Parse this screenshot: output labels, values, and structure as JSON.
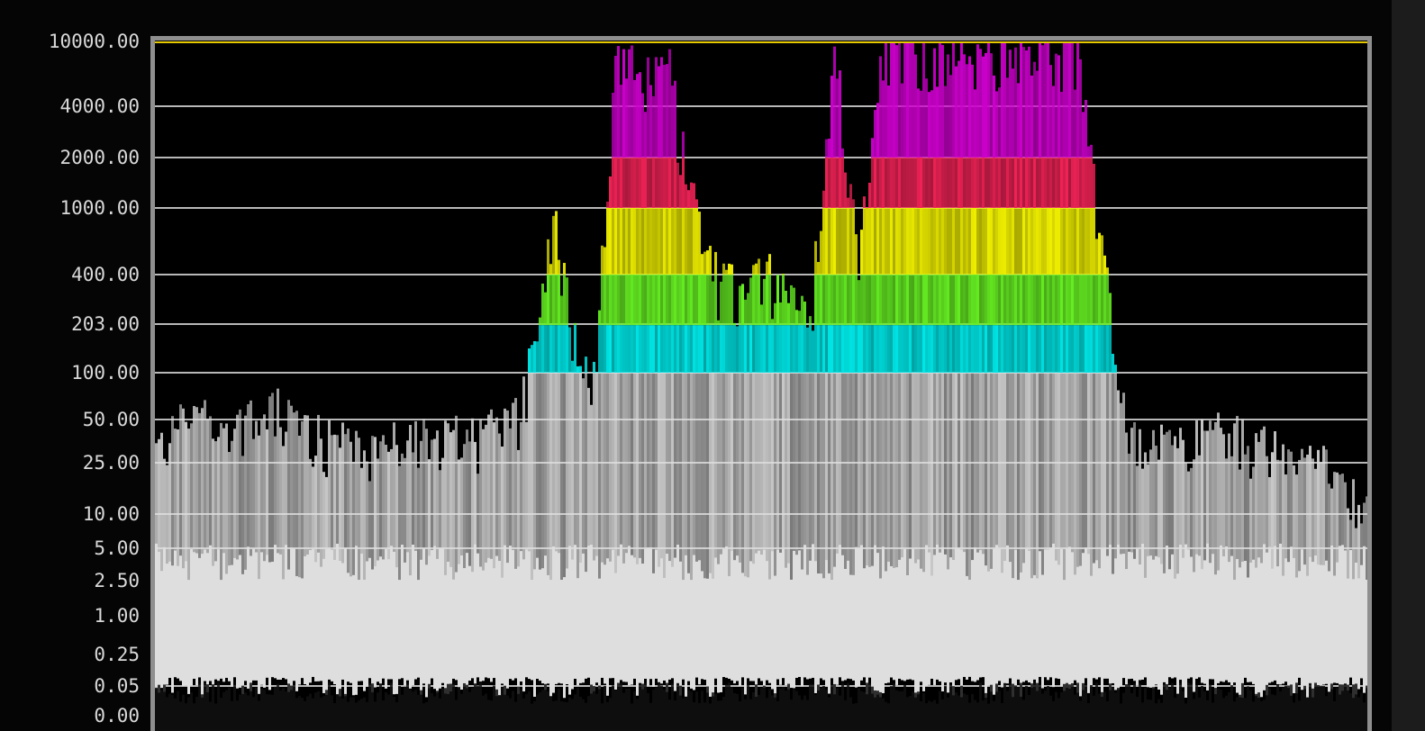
{
  "chart_data": {
    "type": "scatter",
    "title": "",
    "xlabel": "",
    "ylabel": "",
    "yscale": "log",
    "ylim": [
      0,
      10000
    ],
    "y_ticks": [
      "10000.00",
      "4000.00",
      "2000.00",
      "1000.00",
      "400.00",
      "203.00",
      "100.00",
      "50.00",
      "25.00",
      "10.00",
      "5.00",
      "2.50",
      "1.00",
      "0.25",
      "0.05",
      "0.00"
    ],
    "y_tick_values": [
      10000,
      4000,
      2000,
      1000,
      400,
      203,
      100,
      50,
      25,
      10,
      5,
      2.5,
      1,
      0.25,
      0.05,
      0
    ],
    "x_range": [
      0,
      1
    ],
    "peak_luminance_envelope": {
      "x": [
        0.0,
        0.03,
        0.06,
        0.1,
        0.14,
        0.18,
        0.22,
        0.26,
        0.3,
        0.33,
        0.34,
        0.36,
        0.38,
        0.4,
        0.42,
        0.44,
        0.46,
        0.48,
        0.5,
        0.52,
        0.54,
        0.56,
        0.58,
        0.6,
        0.62,
        0.64,
        0.66,
        0.68,
        0.7,
        0.72,
        0.74,
        0.76,
        0.8,
        0.84,
        0.88,
        0.92,
        0.96,
        1.0
      ],
      "y": [
        30,
        60,
        40,
        55,
        35,
        30,
        40,
        35,
        50,
        900,
        250,
        80,
        10000,
        6000,
        9000,
        1200,
        400,
        300,
        400,
        300,
        250,
        9000,
        500,
        10000,
        8000,
        8000,
        8000,
        8000,
        8000,
        8000,
        8000,
        8000,
        40,
        30,
        40,
        30,
        25,
        10
      ]
    },
    "sdr_reference_white": 203,
    "hdr_color_threshold": 100,
    "hdr_color_bands": [
      {
        "from": 100,
        "to": 200,
        "color": "#00e5e5"
      },
      {
        "from": 200,
        "to": 400,
        "color": "#66ee22"
      },
      {
        "from": 400,
        "to": 1000,
        "color": "#eeee00"
      },
      {
        "from": 1000,
        "to": 2000,
        "color": "#ee2255"
      },
      {
        "from": 2000,
        "to": 10000,
        "color": "#cc00cc"
      }
    ],
    "colors": {
      "background": "#000000",
      "sdr_fill": "#dedede",
      "gridline": "#b8b8b8",
      "max_line": "#e6c800",
      "border": "#8f8f8f",
      "tick_text": "#d9d9d9"
    },
    "grid": true,
    "legend": "none"
  }
}
